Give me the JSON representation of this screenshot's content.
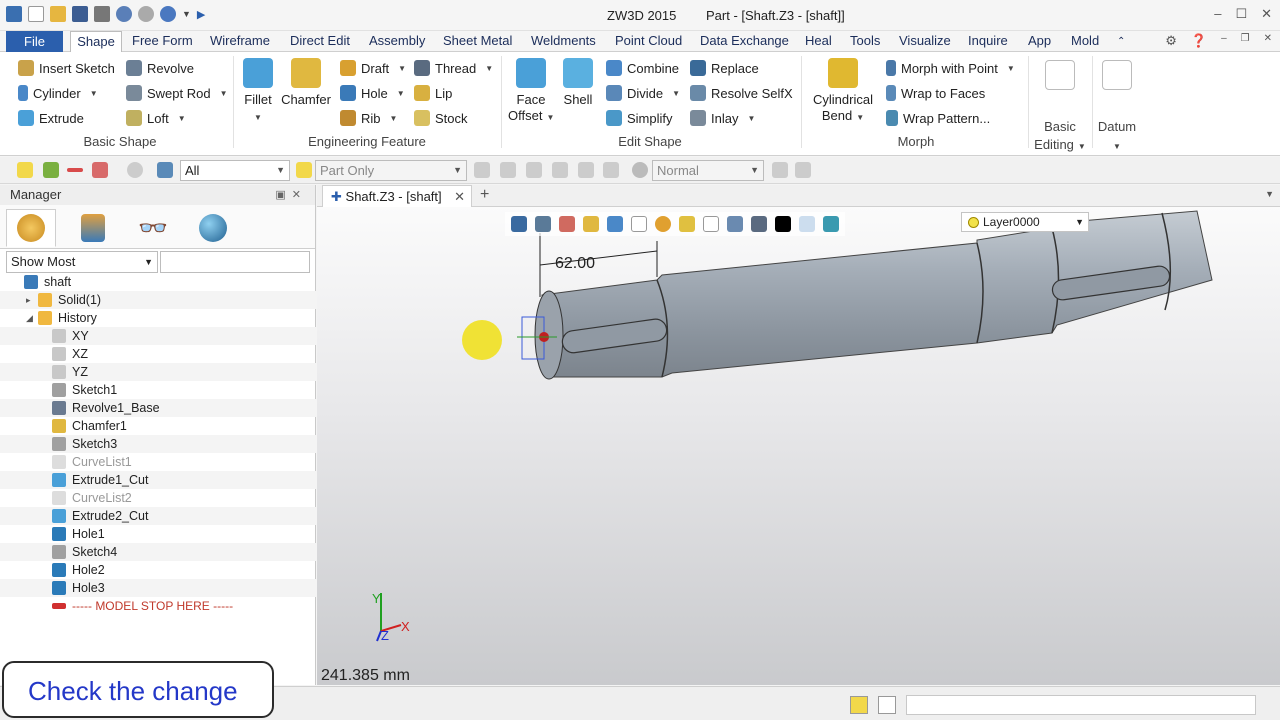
{
  "app": {
    "name": "ZW3D 2015",
    "document_title": "Part - [Shaft.Z3 - [shaft]]"
  },
  "menu": {
    "items": [
      "File",
      "Shape",
      "Free Form",
      "Wireframe",
      "Direct Edit",
      "Assembly",
      "Sheet Metal",
      "Weldments",
      "Point Cloud",
      "Data Exchange",
      "Heal",
      "Tools",
      "Visualize",
      "Inquire",
      "App",
      "Mold"
    ]
  },
  "ribbon": {
    "basic_shape": {
      "label": "Basic Shape",
      "insert_sketch": "Insert Sketch",
      "revolve": "Revolve",
      "cylinder": "Cylinder",
      "swept_rod": "Swept Rod",
      "extrude": "Extrude",
      "loft": "Loft"
    },
    "engineering_feature": {
      "label": "Engineering Feature",
      "fillet": "Fillet",
      "chamfer": "Chamfer",
      "draft": "Draft",
      "thread": "Thread",
      "hole": "Hole",
      "lip": "Lip",
      "rib": "Rib",
      "stock": "Stock"
    },
    "edit_shape": {
      "label": "Edit Shape",
      "face_offset": "Face Offset",
      "shell": "Shell",
      "combine": "Combine",
      "replace": "Replace",
      "divide": "Divide",
      "resolve_selfx": "Resolve SelfX",
      "simplify": "Simplify",
      "inlay": "Inlay"
    },
    "morph": {
      "label": "Morph",
      "cylindrical_bend": "Cylindrical Bend",
      "morph_with_point": "Morph with Point",
      "wrap_to_faces": "Wrap to Faces",
      "wrap_pattern": "Wrap Pattern..."
    },
    "basic_editing": {
      "label": "Basic Editing"
    },
    "datum": {
      "label": "Datum"
    }
  },
  "toolbar2": {
    "filter_value": "All",
    "scope_value": "Part Only",
    "view_mode": "Normal"
  },
  "manager": {
    "title": "Manager",
    "show_mode": "Show Most",
    "tree": [
      {
        "label": "shaft",
        "level": 0,
        "icon": "part-icon",
        "exp": ""
      },
      {
        "label": "Solid(1)",
        "level": 1,
        "icon": "folder-icon",
        "exp": "▸"
      },
      {
        "label": "History",
        "level": 1,
        "icon": "folder-icon",
        "exp": "◢"
      },
      {
        "label": "XY",
        "level": 2,
        "icon": "datum-plane-icon",
        "exp": ""
      },
      {
        "label": "XZ",
        "level": 2,
        "icon": "datum-plane-icon",
        "exp": ""
      },
      {
        "label": "YZ",
        "level": 2,
        "icon": "datum-plane-icon",
        "exp": ""
      },
      {
        "label": "Sketch1",
        "level": 2,
        "icon": "sketch-icon",
        "exp": ""
      },
      {
        "label": "Revolve1_Base",
        "level": 2,
        "icon": "revolve-icon",
        "exp": ""
      },
      {
        "label": "Chamfer1",
        "level": 2,
        "icon": "chamfer-icon",
        "exp": ""
      },
      {
        "label": "Sketch3",
        "level": 2,
        "icon": "sketch-icon",
        "exp": ""
      },
      {
        "label": "CurveList1",
        "level": 2,
        "icon": "curvelist-icon",
        "exp": "",
        "gray": true
      },
      {
        "label": "Extrude1_Cut",
        "level": 2,
        "icon": "extrude-icon",
        "exp": ""
      },
      {
        "label": "CurveList2",
        "level": 2,
        "icon": "curvelist-icon",
        "exp": "",
        "gray": true
      },
      {
        "label": "Extrude2_Cut",
        "level": 2,
        "icon": "extrude-icon",
        "exp": ""
      },
      {
        "label": "Hole1",
        "level": 2,
        "icon": "hole-icon",
        "exp": ""
      },
      {
        "label": "Sketch4",
        "level": 2,
        "icon": "sketch-icon",
        "exp": ""
      },
      {
        "label": "Hole2",
        "level": 2,
        "icon": "hole-icon",
        "exp": ""
      },
      {
        "label": "Hole3",
        "level": 2,
        "icon": "hole-icon",
        "exp": ""
      },
      {
        "label": "----- MODEL STOP HERE -----",
        "level": 2,
        "icon": "stop-arrow-icon",
        "exp": "",
        "stop": true
      }
    ]
  },
  "viewport": {
    "tab_label": "Shaft.Z3 - [shaft]",
    "layer": "Layer0000",
    "dimension": "62.00",
    "measurement": "241.385 mm",
    "axis_labels": {
      "x": "X",
      "y": "Y",
      "z": "Z"
    }
  },
  "caption": "Check the change",
  "colors": {
    "accent": "#2b5fad",
    "caption_text": "#2438c8",
    "stop_text": "#c0392b"
  }
}
